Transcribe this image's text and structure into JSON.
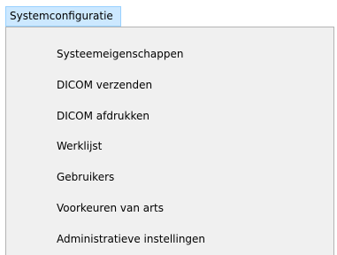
{
  "menubar": {
    "active_menu": "Systemconfiguratie"
  },
  "dropdown": {
    "items": [
      {
        "label": "Systeemeigenschappen"
      },
      {
        "label": "DICOM verzenden"
      },
      {
        "label": "DICOM afdrukken"
      },
      {
        "label": "Werklijst"
      },
      {
        "label": "Gebruikers"
      },
      {
        "label": "Voorkeuren van arts"
      },
      {
        "label": "Administratieve instellingen"
      }
    ]
  },
  "colors": {
    "menubar_highlight": "#cce8ff",
    "menubar_highlight_border": "#99d1ff",
    "dropdown_background": "#f0f0f0",
    "dropdown_border": "#b4b4b4"
  }
}
